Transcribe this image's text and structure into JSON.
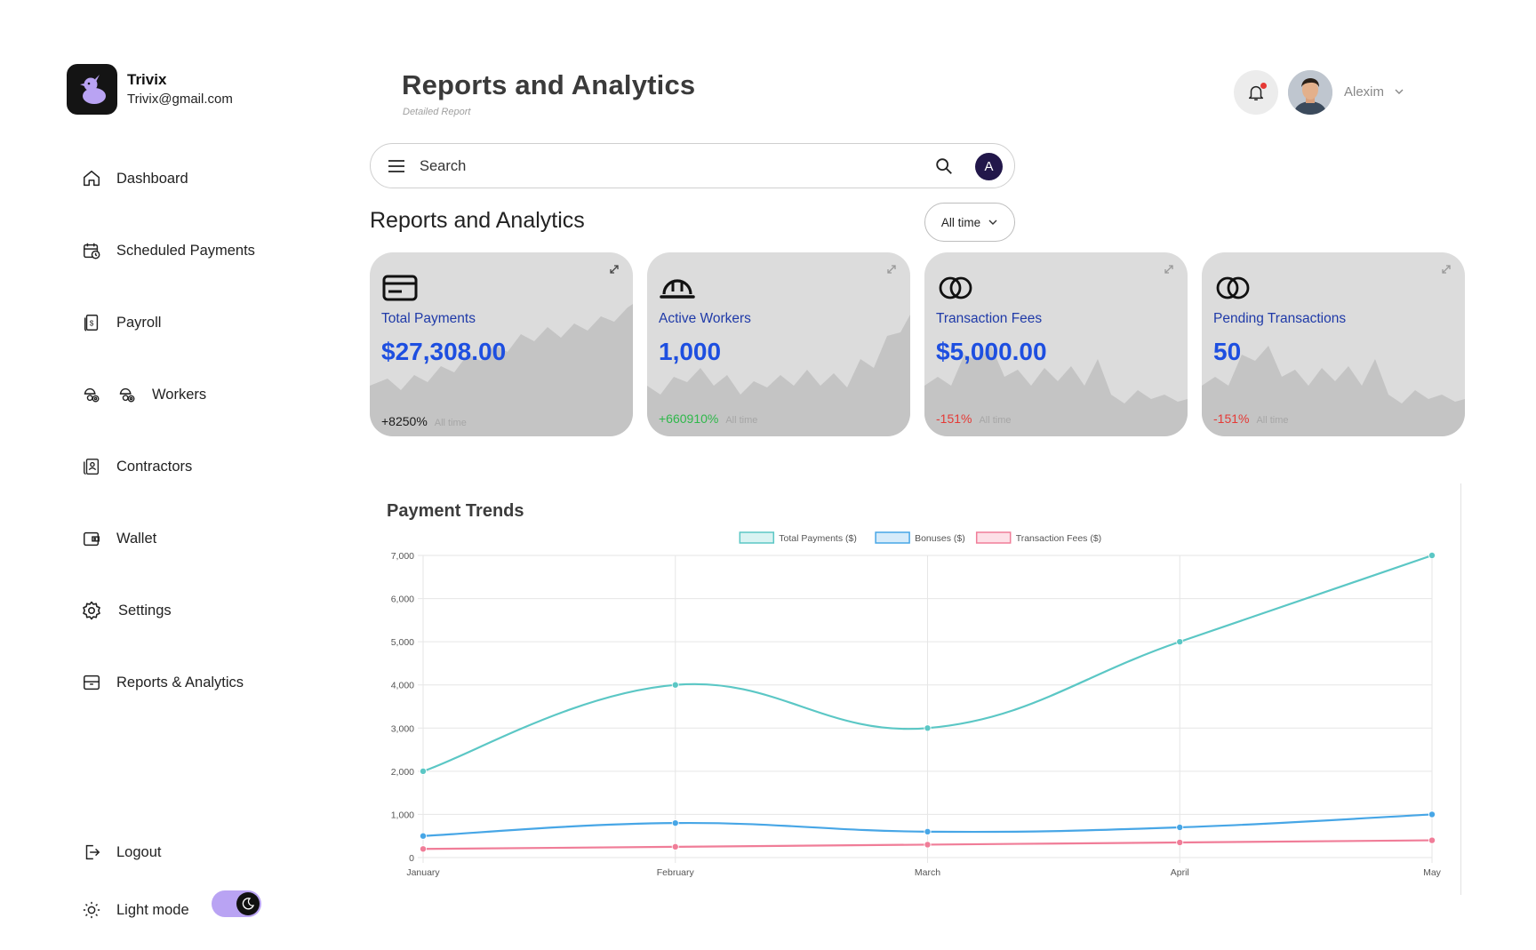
{
  "brand": {
    "name": "Trivix",
    "email": "Trivix@gmail.com"
  },
  "nav": {
    "dashboard": "Dashboard",
    "scheduled_payments": "Scheduled Payments",
    "payroll": "Payroll",
    "workers": "Workers",
    "contractors": "Contractors",
    "wallet": "Wallet",
    "settings": "Settings",
    "reports": "Reports & Analytics",
    "logout": "Logout",
    "light_mode": "Light mode"
  },
  "header": {
    "title": "Reports and Analytics",
    "subtitle": "Detailed Report",
    "user_name": "Alexim"
  },
  "search": {
    "placeholder": "Search",
    "account_initial": "A"
  },
  "section": {
    "title": "Reports and Analytics",
    "filter_label": "All time"
  },
  "cards": [
    {
      "icon": "credit-card-icon",
      "label": "Total Payments",
      "value": "$27,308.00",
      "change": "+8250%",
      "period": "All time",
      "change_color": "#1a1a1a"
    },
    {
      "icon": "hard-hat-icon",
      "label": "Active Workers",
      "value": "1,000",
      "change": "+660910%",
      "period": "All time",
      "change_color": "#2eb84a"
    },
    {
      "icon": "rings-icon",
      "label": "Transaction Fees",
      "value": "$5,000.00",
      "change": "-151%",
      "period": "All time",
      "change_color": "#e53935"
    },
    {
      "icon": "rings-icon",
      "label": "Pending Transactions",
      "value": "50",
      "change": "-151%",
      "period": "All time",
      "change_color": "#e53935"
    }
  ],
  "chart_title": "Payment Trends",
  "chart_data": {
    "type": "line",
    "title": "Payment Trends",
    "categories": [
      "January",
      "February",
      "March",
      "April",
      "May"
    ],
    "ylim": [
      0,
      7000
    ],
    "yticks": [
      0,
      1000,
      2000,
      3000,
      4000,
      5000,
      6000,
      7000
    ],
    "ytick_labels": [
      "0",
      "1,000",
      "2,000",
      "3,000",
      "4,000",
      "5,000",
      "6,000",
      "7,000"
    ],
    "grid": true,
    "legend_position": "top-center",
    "series": [
      {
        "name": "Total Payments ($)",
        "values": [
          2000,
          4000,
          3000,
          5000,
          7000
        ],
        "color": "#5bc7c5",
        "fill": "#d9f3f2"
      },
      {
        "name": "Bonuses ($)",
        "values": [
          500,
          800,
          600,
          700,
          1000
        ],
        "color": "#47a6e6",
        "fill": "#d6ebfa"
      },
      {
        "name": "Transaction Fees ($)",
        "values": [
          200,
          250,
          300,
          350,
          400
        ],
        "color": "#f07d98",
        "fill": "#fde0e7"
      }
    ]
  }
}
